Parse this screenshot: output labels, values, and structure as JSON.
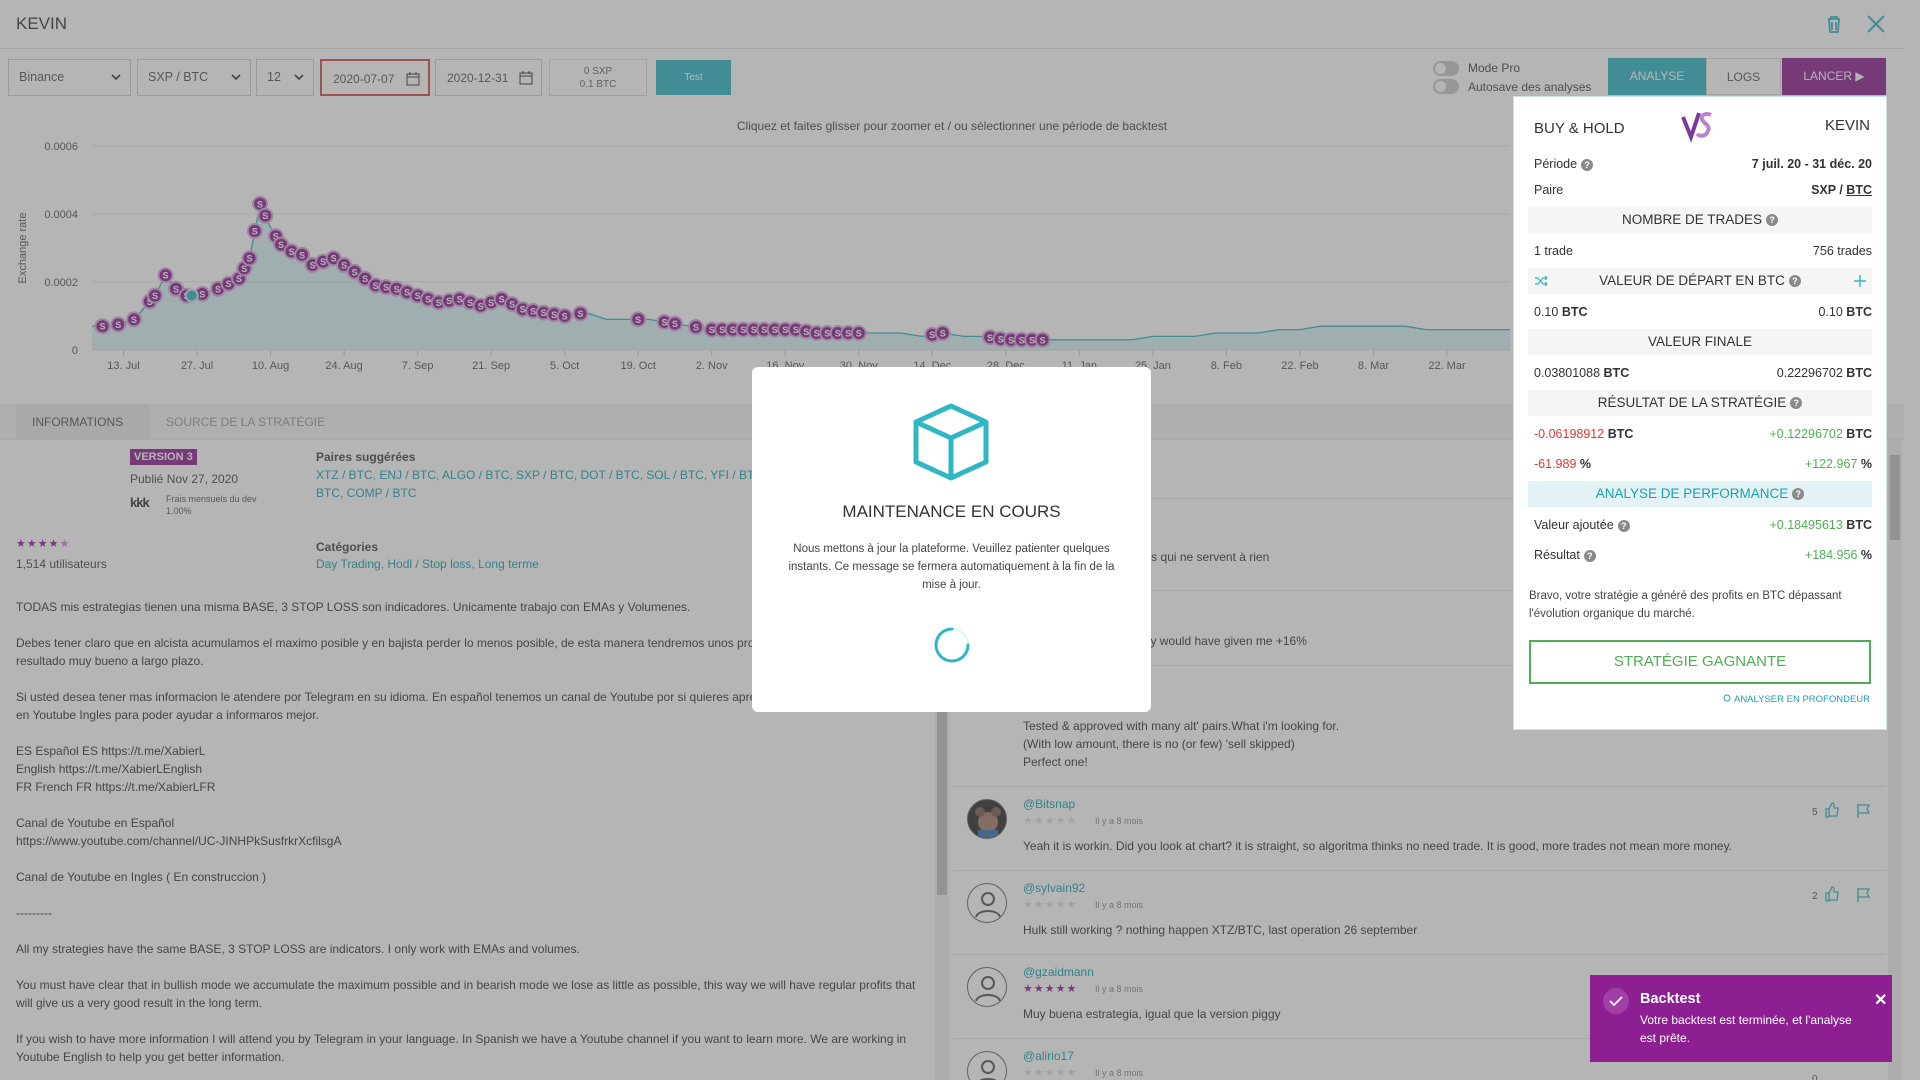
{
  "header": {
    "title": "KEVIN"
  },
  "toolbar": {
    "exchange": "Binance",
    "pair": "SXP / BTC",
    "timeframe": "12",
    "start_date": "2020-07-07",
    "end_date": "2020-12-31",
    "balance_coin": "0 SXP",
    "balance_btc": "0.1 BTC",
    "test_label": "Test",
    "mode_pro_label": "Mode Pro",
    "autosave_label": "Autosave des analyses",
    "mode_pro_on": false,
    "autosave_on": false,
    "tab_analyse": "ANALYSE",
    "tab_logs": "LOGS",
    "launch_label": "LANCER ▶"
  },
  "chart_hint": "Cliquez et faites glisser pour zoomer et / ou sélectionner une période de backtest",
  "chart_data": {
    "type": "area",
    "ylabel": "Exchange rate",
    "y_ticks": [
      "0.0006",
      "0.0004",
      "0.0002",
      "0"
    ],
    "ylim": [
      0,
      0.0006
    ],
    "x_ticks": [
      "13. Jul",
      "27. Jul",
      "10. Aug",
      "24. Aug",
      "7. Sep",
      "21. Sep",
      "5. Oct",
      "19. Oct",
      "2. Nov",
      "16. Nov",
      "30. Nov",
      "14. Dec",
      "28. Dec",
      "11. Jan",
      "25. Jan",
      "8. Feb",
      "22. Feb",
      "8. Mar",
      "22. Mar"
    ],
    "x_tick_days": [
      6,
      20,
      34,
      48,
      62,
      76,
      90,
      104,
      118,
      132,
      146,
      160,
      174,
      188,
      202,
      216,
      230,
      244,
      258
    ],
    "x_days_domain": [
      0,
      270
    ],
    "series": [
      {
        "x": [
          0,
          4,
          8,
          12,
          14,
          16,
          18,
          20,
          24,
          28,
          30,
          32,
          34,
          36,
          38,
          40,
          42,
          44,
          46,
          50,
          54,
          58,
          62,
          66,
          70,
          74,
          78,
          82,
          86,
          90,
          94,
          98,
          102,
          106,
          110,
          114,
          118,
          122,
          126,
          130,
          134,
          138,
          142,
          146,
          150,
          154,
          158,
          162,
          166,
          170,
          174,
          178,
          182,
          186,
          190,
          194,
          198,
          202,
          206,
          210,
          214,
          218,
          222,
          226,
          230,
          234,
          238,
          242,
          246,
          250,
          254,
          258,
          262,
          266,
          270
        ],
        "values": [
          7e-05,
          7e-05,
          9e-05,
          0.00016,
          0.00022,
          0.00018,
          0.00016,
          0.00016,
          0.00018,
          0.00021,
          0.00027,
          0.00043,
          0.00036,
          0.00031,
          0.00029,
          0.00028,
          0.00025,
          0.00026,
          0.00027,
          0.00023,
          0.00019,
          0.00018,
          0.00016,
          0.00014,
          0.00015,
          0.00013,
          0.00015,
          0.00012,
          0.00011,
          0.0001,
          0.00011,
          9e-05,
          9e-05,
          9e-05,
          8e-05,
          7e-05,
          6e-05,
          6e-05,
          6e-05,
          6e-05,
          6e-05,
          5e-05,
          5e-05,
          5e-05,
          5e-05,
          5e-05,
          4e-05,
          5e-05,
          4e-05,
          4e-05,
          3e-05,
          3e-05,
          3e-05,
          3e-05,
          3e-05,
          3e-05,
          3e-05,
          4e-05,
          4e-05,
          4e-05,
          5e-05,
          5e-05,
          5e-05,
          6e-05,
          6e-05,
          7e-05,
          7e-05,
          7e-05,
          7e-05,
          7e-05,
          6e-05,
          6e-05,
          6e-05,
          6e-05,
          6e-05
        ]
      }
    ],
    "sell_markers_x": [
      2,
      5,
      8,
      11,
      12,
      14,
      16,
      18,
      21,
      24,
      26,
      28,
      29,
      30,
      31,
      32,
      33,
      35,
      36,
      38,
      40,
      42,
      44,
      46,
      48,
      50,
      52,
      54,
      56,
      58,
      60,
      62,
      64,
      66,
      68,
      70,
      72,
      74,
      76,
      78,
      80,
      82,
      84,
      86,
      88,
      90,
      93,
      104,
      109,
      111,
      115,
      118,
      120,
      122,
      124,
      126,
      128,
      130,
      132,
      134,
      136,
      138,
      140,
      142,
      144,
      146,
      160,
      162,
      171,
      173,
      175,
      177,
      179,
      181
    ],
    "buy_markers_x": [
      19
    ]
  },
  "info_tabs": [
    "INFORMATIONS",
    "SOURCE DE LA STRATÉGIE"
  ],
  "info": {
    "version": "VERSION 3",
    "published": "Publié Nov 27, 2020",
    "fees_label": "Frais mensuels du dev",
    "fees_value": "1.00%",
    "suggested_label": "Paires suggérées",
    "suggested_line1": "XTZ / BTC, ENJ / BTC, ALGO / BTC, SXP / BTC, DOT / BTC, SOL / BTC, YFI / BTC, N",
    "suggested_line2": "BTC, COMP / BTC",
    "rating_stars": 4.5,
    "users": "1,514 utilisateurs",
    "categories_label": "Catégories",
    "categories": "Day Trading, Hodl / Stop loss, Long terme"
  },
  "description": [
    "TODAS mis estrategias tienen una misma BASE, 3 STOP LOSS son indicadores. Unicamente trabajo con EMAs y Volumenes.",
    "Debes tener claro que en alcista acumulamos el maximo posible y en bajista perder lo menos posible, de esta manera tendremos unos pro",
    "resultado muy bueno a largo plazo.",
    "Si usted desea tener mas informacion le atendere por Telegram en su idioma. En español tenemos un canal de Youtube por si quieres apre",
    "en Youtube Ingles para poder ayudar a informaros mejor.",
    "ES Español ES https://t.me/XabierL",
    "English https://t.me/XabierLEnglish",
    "FR French FR https://t.me/XabierLFR",
    "Canal de Youtube en Español",
    "https://www.youtube.com/channel/UC-JINHPkSusfrkrXcfilsgA",
    "Canal de Youtube en Ingles ( En construccion )",
    "---------",
    "All my strategies have the same BASE, 3 STOP LOSS are indicators. I only work with EMAs and volumes.",
    "You must have clear that in bullish mode we accumulate the maximum possible and in bearish mode we lose as little as possible, this way we will have regular profits that",
    "will give us a very good result in the long term.",
    "If you wish to have more information I will attend you by Telegram in your language. In Spanish we have a Youtube channel if you want to learn more. We are working in",
    "Youtube English to help you get better information."
  ],
  "partial_comments": {
    "c1": "it la differance avec d'autres strategies qui ne servent à rien",
    "c2": "s time... even though the hold strategy would have given me +16%",
    "c3_l1": "Tested & approved with many alt' pairs.What i'm looking for.",
    "c3_l2": "(With low amount, there is no (or few) 'sell skipped)",
    "c3_l3": "Perfect one!"
  },
  "comments": [
    {
      "name": "@Bitsnap",
      "date": "Il y a 8 mois",
      "stars": 0,
      "text": "Yeah it is workin. Did you look at chart? it is straight, so algoritma thinks no need trade. It is good, more trades not mean more money.",
      "likes": "5"
    },
    {
      "name": "@sylvain92",
      "date": "Il y a 8 mois",
      "stars": 0,
      "text": "Hulk still working ?  nothing happen XTZ/BTC, last operation 26 september",
      "likes": "2"
    },
    {
      "name": "@gzaidmann",
      "date": "Il y a 8 mois",
      "stars": 5,
      "text": "Muy buena estrategia, igual que la version piggy",
      "likes": ""
    },
    {
      "name": "@alirio17",
      "date": "Il y a 8 mois",
      "stars": 0,
      "text": "",
      "likes": "0"
    }
  ],
  "panel": {
    "title": "BUY & HOLD",
    "name": "KEVIN",
    "periode_label": "Période",
    "periode_value": "7 juil. 20 - 31 déc. 20",
    "paire_label": "Paire",
    "paire_base": "SXP / ",
    "paire_quote": "BTC",
    "trades_header": "NOMBRE DE TRADES",
    "trades_left": "1 trade",
    "trades_right": "756 trades",
    "start_header": "VALEUR DE DÉPART EN BTC",
    "start_left": "0.10",
    "start_right": "0.10",
    "unit": "BTC",
    "final_header": "VALEUR FINALE",
    "final_left": "0.03801088",
    "final_right": "0.22296702",
    "result_header": "RÉSULTAT DE LA STRATÉGIE",
    "result_left": "-0.06198912",
    "result_right": "+0.12296702",
    "pct_left": "-61.989",
    "pct_right": "+122.967",
    "pct_unit": "%",
    "perf_header": "ANALYSE DE PERFORMANCE",
    "added_label": "Valeur ajoutée",
    "added_value": "+0.18495613",
    "resultat_label": "Résultat",
    "resultat_value": "+184.956",
    "bravo_l1": "Bravo, votre stratégie a généré des profits en BTC dépassant",
    "bravo_l2": "l'évolution organique du marché.",
    "winner_label": "STRATÉGIE GAGNANTE",
    "deep_link": "ANALYSER EN PROFONDEUR"
  },
  "modal": {
    "title": "MAINTENANCE EN COURS",
    "line1": "Nous mettons à jour la plateforme. Veuillez patienter quelques",
    "line2": "instants. Ce message se fermera automatiquement à la fin de la",
    "line3": "mise à jour."
  },
  "toast": {
    "title": "Backtest",
    "line1": "Votre backtest est terminée, et l'analyse",
    "line2": "est prête."
  },
  "colors": {
    "teal": "#2fb7c3",
    "purple": "#8e1f92",
    "green": "#4fae53",
    "red": "#d63a3a"
  }
}
